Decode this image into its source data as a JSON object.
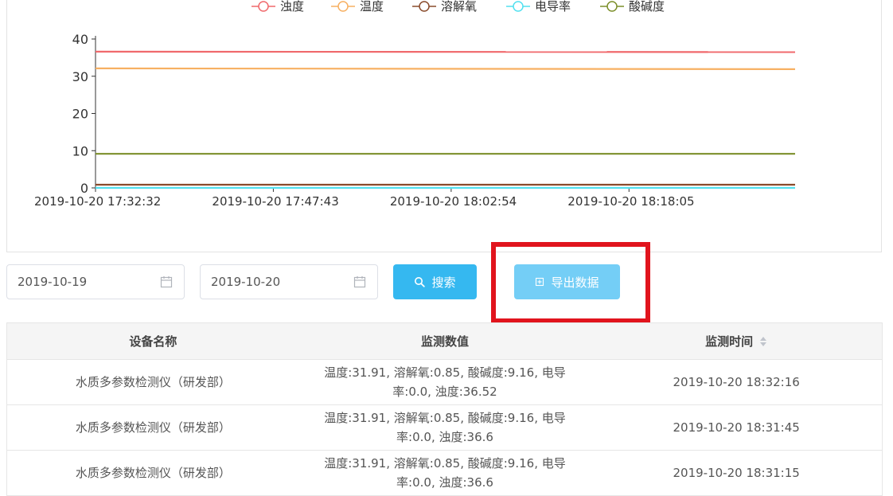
{
  "chart_data": {
    "type": "line",
    "legend_position": "top-center",
    "x_ticks": [
      "2019-10-20 17:32:32",
      "2019-10-20 17:47:43",
      "2019-10-20 18:02:54",
      "2019-10-20 18:18:05"
    ],
    "x": [
      "2019-10-20 17:32:32",
      "2019-10-20 18:32:16"
    ],
    "ylim": [
      0,
      40
    ],
    "y_ticks": [
      0,
      10,
      20,
      30,
      40
    ],
    "grid": false,
    "series": [
      {
        "name": "浊度",
        "color": "#f0696c",
        "values": [
          36.6,
          36.5
        ]
      },
      {
        "name": "温度",
        "color": "#f7b062",
        "values": [
          32.1,
          31.9
        ]
      },
      {
        "name": "溶解氧",
        "color": "#8a4b2c",
        "values": [
          0.85,
          0.85
        ]
      },
      {
        "name": "电导率",
        "color": "#52e0ef",
        "values": [
          0.0,
          0.0
        ]
      },
      {
        "name": "酸碱度",
        "color": "#7c8f2a",
        "values": [
          9.16,
          9.16
        ]
      }
    ]
  },
  "filters": {
    "start_date": "2019-10-19",
    "end_date": "2019-10-20"
  },
  "buttons": {
    "search_label": "搜索",
    "export_label": "导出数据"
  },
  "table": {
    "headers": [
      "设备名称",
      "监测数值",
      "监测时间"
    ],
    "rows": [
      {
        "device": "水质多参数检测仪（研发部）",
        "values": "温度:31.91, 溶解氧:0.85, 酸碱度:9.16, 电导率:0.0, 浊度:36.52",
        "time": "2019-10-20 18:32:16"
      },
      {
        "device": "水质多参数检测仪（研发部）",
        "values": "温度:31.91, 溶解氧:0.85, 酸碱度:9.16, 电导率:0.0, 浊度:36.6",
        "time": "2019-10-20 18:31:45"
      },
      {
        "device": "水质多参数检测仪（研发部）",
        "values": "温度:31.91, 溶解氧:0.85, 酸碱度:9.16, 电导率:0.0, 浊度:36.6",
        "time": "2019-10-20 18:31:15"
      }
    ]
  },
  "colors": {
    "primary": "#35b8f0",
    "export_button": "#74cef6",
    "highlight": "#e1141d"
  }
}
